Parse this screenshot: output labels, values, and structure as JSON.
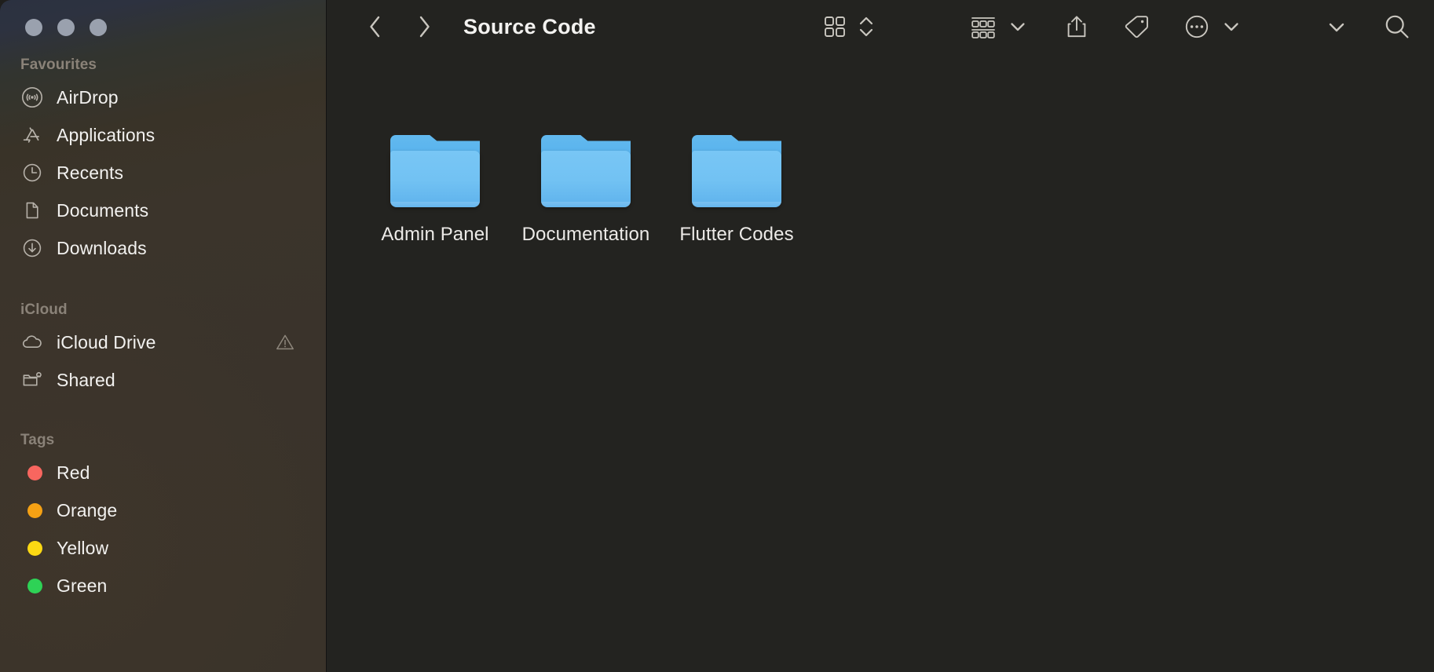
{
  "window": {
    "title": "Source Code",
    "traffic_lights": [
      {
        "name": "close",
        "color": "#9aa1ae"
      },
      {
        "name": "minimize",
        "color": "#9aa1ae"
      },
      {
        "name": "zoom",
        "color": "#9aa1ae"
      }
    ]
  },
  "sidebar": {
    "sections": [
      {
        "title": "Favourites",
        "items": [
          {
            "label": "AirDrop",
            "icon": "airdrop-icon"
          },
          {
            "label": "Applications",
            "icon": "applications-icon"
          },
          {
            "label": "Recents",
            "icon": "clock-icon"
          },
          {
            "label": "Documents",
            "icon": "document-icon"
          },
          {
            "label": "Downloads",
            "icon": "download-icon"
          }
        ]
      },
      {
        "title": "iCloud",
        "items": [
          {
            "label": "iCloud Drive",
            "icon": "cloud-icon",
            "trailing_icon": "warning-triangle-icon"
          },
          {
            "label": "Shared",
            "icon": "shared-folder-icon"
          }
        ]
      },
      {
        "title": "Tags",
        "items": [
          {
            "label": "Red",
            "icon": "tag-dot",
            "color": "#f8665f"
          },
          {
            "label": "Orange",
            "icon": "tag-dot",
            "color": "#f5a114"
          },
          {
            "label": "Yellow",
            "icon": "tag-dot",
            "color": "#fcd913"
          },
          {
            "label": "Green",
            "icon": "tag-dot",
            "color": "#2ed256"
          }
        ]
      }
    ]
  },
  "toolbar": {
    "back_icon": "chevron-left-icon",
    "forward_icon": "chevron-right-icon",
    "path_title": "Source Code",
    "view_icon": "icon-view-grid-icon",
    "view_stepper_icon": "chevron-up-down-icon",
    "group_icon": "group-by-icon",
    "group_chevron_icon": "chevron-down-icon",
    "share_icon": "share-icon",
    "tag_icon": "tag-icon",
    "more_icon": "ellipsis-circle-icon",
    "more_chevron_icon": "chevron-down-icon",
    "overflow_icon": "chevron-down-icon",
    "search_icon": "search-icon"
  },
  "main": {
    "files": [
      {
        "name": "Admin Panel",
        "kind": "folder"
      },
      {
        "name": "Documentation",
        "kind": "folder"
      },
      {
        "name": "Flutter Codes",
        "kind": "folder"
      }
    ]
  },
  "colors": {
    "sidebar_top": "#2b3140",
    "sidebar_bottom": "#3a332a",
    "content_bg": "#232320",
    "folder_blue": "#72c2f3",
    "folder_blue_dark": "#56b1ec",
    "text_primary": "#f2f1ef",
    "section_header": "#8a8278",
    "icon_grey": "#b6b1a9"
  }
}
